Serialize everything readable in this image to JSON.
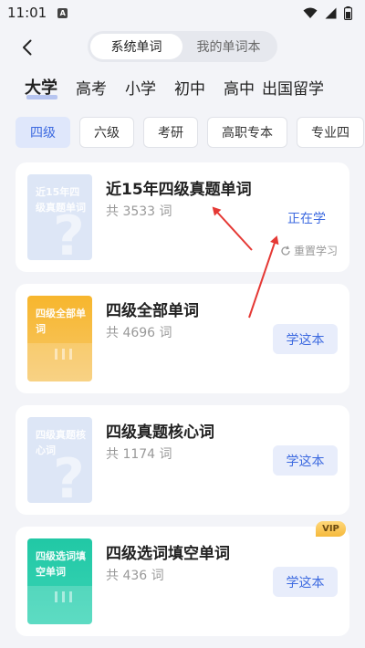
{
  "status": {
    "time": "11:01",
    "notice": "A"
  },
  "nav": {
    "tabs": [
      {
        "label": "系统单词",
        "active": true
      },
      {
        "label": "我的单词本",
        "active": false
      }
    ]
  },
  "levels": [
    "大学",
    "高考",
    "小学",
    "初中",
    "高中",
    "出国留学"
  ],
  "active_level": "大学",
  "categories": [
    "四级",
    "六级",
    "考研",
    "高职专本",
    "专业四"
  ],
  "active_category": "四级",
  "books": [
    {
      "cover_text": "近15年四级真题单词",
      "title": "近15年四级真题单词",
      "count": "共 3533 词",
      "status": "正在学",
      "reset": "重置学习",
      "cover": "blue"
    },
    {
      "cover_text": "四级全部单词",
      "title": "四级全部单词",
      "count": "共 4696 词",
      "action": "学这本",
      "cover": "yellow"
    },
    {
      "cover_text": "四级真题核心词",
      "title": "四级真题核心词",
      "count": "共 1174 词",
      "action": "学这本",
      "cover": "blue"
    },
    {
      "cover_text": "四级选词填空单词",
      "title": "四级选词填空单词",
      "count": "共 436 词",
      "action": "学这本",
      "cover": "green",
      "badge": "VIP"
    }
  ],
  "colors": {
    "accent": "#3d6ae0",
    "arrow": "#e53935"
  }
}
